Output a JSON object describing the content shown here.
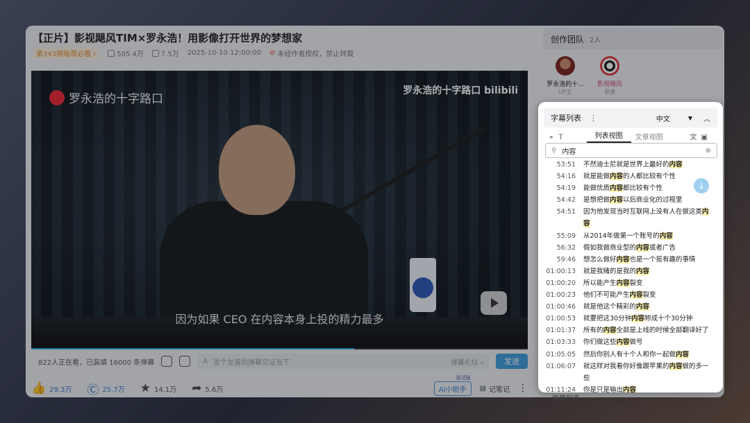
{
  "video": {
    "title": "【正片】影视飓风TIM×罗永浩！用影像打开世界的梦想家",
    "weekly_tag": "第343期每周必看 ›",
    "views": "505.4万",
    "danmaku_count": "7.5万",
    "publish_time": "2025-10-10 12:00:00",
    "reprint_notice": "未经作者授权，禁止转载"
  },
  "player": {
    "logo_left": "罗永浩的十字路口",
    "logo_right": "罗永浩的十字路口 bilibili",
    "subtitle": "因为如果 CEO 在内容本身上投的精力最多"
  },
  "danmaku_bar": {
    "online": "822人正在看，已装填 16000 条弹幕",
    "input_placeholder": "发个友善的弹幕见证当下",
    "etiquette": "弹幕礼仪 ›",
    "send_label": "发送"
  },
  "actions": {
    "like": "29.3万",
    "coin": "25.7万",
    "favorite": "14.1万",
    "share": "5.6万",
    "ai_label": "AI小助手",
    "ai_badge": "测试版",
    "notes_label": "记笔记"
  },
  "team": {
    "title": "创作团队",
    "count": "2人",
    "members": [
      {
        "name": "罗永浩的十...",
        "role": "UP主"
      },
      {
        "name": "影视飓风",
        "role": "参演"
      }
    ]
  },
  "subtitle_panel": {
    "title": "字幕列表",
    "language": "中文",
    "tab_list": "列表视图",
    "tab_article": "文章视图",
    "search_value": "内容",
    "rows": [
      {
        "time": "53:51",
        "pre": "不然迪士尼就是世界上最好的",
        "hit": "内容",
        "post": ""
      },
      {
        "time": "54:16",
        "pre": "就是能做",
        "hit": "内容",
        "post": "的人都比较有个性"
      },
      {
        "time": "54:19",
        "pre": "能做优质",
        "hit": "内容",
        "post": "都比较有个性"
      },
      {
        "time": "54:42",
        "pre": "是想把做",
        "hit": "内容",
        "post": "以后商业化的过程里"
      },
      {
        "time": "54:51",
        "pre": "因为他发现当时互联网上没有人在做这类",
        "hit": "内容",
        "post": ""
      },
      {
        "time": "55:09",
        "pre": "从2014年做第一个账号的",
        "hit": "内容",
        "post": ""
      },
      {
        "time": "56:32",
        "pre": "假如我做商业型的",
        "hit": "内容",
        "post": "或者广告"
      },
      {
        "time": "59:46",
        "pre": "想怎么做好",
        "hit": "内容",
        "post": "也是一个挺有趣的事情"
      },
      {
        "time": "01:00:13",
        "pre": "就是我赌的是我的",
        "hit": "内容",
        "post": ""
      },
      {
        "time": "01:00:20",
        "pre": "所以能产生",
        "hit": "内容",
        "post": "裂变"
      },
      {
        "time": "01:00:23",
        "pre": "他们不可能产生",
        "hit": "内容",
        "post": "裂变"
      },
      {
        "time": "01:00:46",
        "pre": "就是他这个精彩的",
        "hit": "内容",
        "post": ""
      },
      {
        "time": "01:00:53",
        "pre": "就要把这30分钟",
        "hit": "内容",
        "post": "称成十个30分钟"
      },
      {
        "time": "01:01:37",
        "pre": "所有的",
        "hit": "内容",
        "post": "全部是上线的时候全部翻译好了"
      },
      {
        "time": "01:03:33",
        "pre": "你们做这些",
        "hit": "内容",
        "post": "做号"
      },
      {
        "time": "01:05:05",
        "pre": "然后你别人有十个人和你一起做",
        "hit": "内容",
        "post": ""
      },
      {
        "time": "01:06:07",
        "pre": "就这样对我看你好像跟苹果的",
        "hit": "内容",
        "post": "做的多一些"
      },
      {
        "time": "01:11:24",
        "pre": "你是只是输出",
        "hit": "内容",
        "post": ""
      }
    ]
  },
  "bottom_peek": "弹幕列表",
  "colors": {
    "accent": "#3d9bdb",
    "highlight": "#fff3b0",
    "link": "#3576c8"
  }
}
